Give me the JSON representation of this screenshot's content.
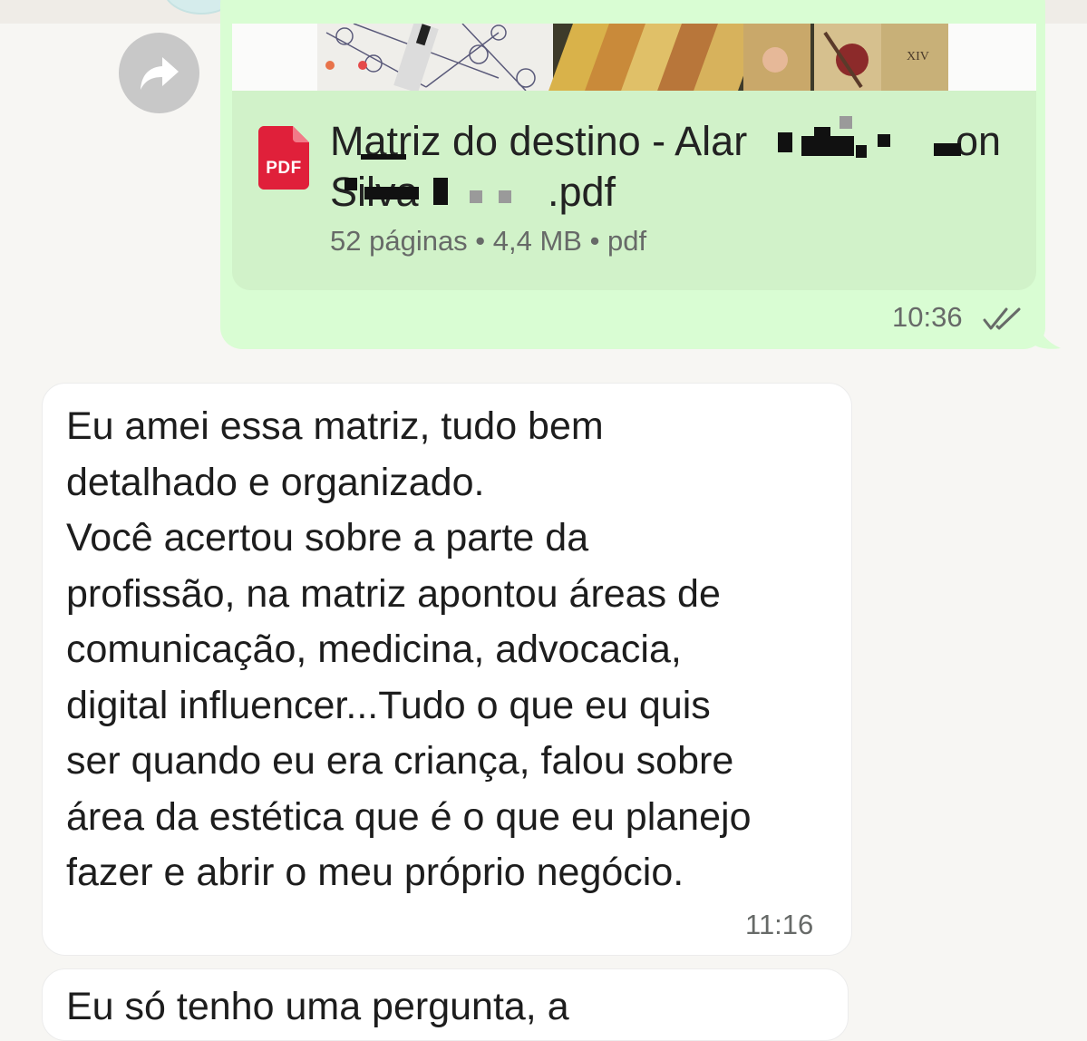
{
  "chat": {
    "forward_icon": "forward-arrow-icon",
    "outgoing": {
      "document": {
        "icon_label": "PDF",
        "name_line1": "Matriz do destino - Alar",
        "name_line1_end": "on",
        "name_line2_start": "Silva",
        "name_line2_end": ".pdf",
        "meta": "52 páginas • 4,4 MB • pdf"
      },
      "time": "10:36",
      "status_icon": "read-double-check-icon"
    },
    "incoming": {
      "lines": [
        "Eu amei essa matriz, tudo bem",
        "detalhado e organizado.",
        "Você acertou sobre a parte da",
        "profissão, na matriz apontou áreas de",
        "comunicação, medicina, advocacia,",
        "digital influencer...Tudo o que eu quis",
        "ser quando eu era criança, falou sobre",
        "área da estética que é o que eu planejo",
        "fazer e abrir o meu próprio negócio."
      ],
      "time": "11:16"
    },
    "incoming_next": {
      "partial_text": "Eu só tenho uma pergunta, a"
    },
    "colors": {
      "outgoing_bubble": "#d9fdd3",
      "document_card": "#d1f2c9",
      "pdf_red": "#e0203a",
      "incoming_bubble": "#ffffff",
      "background": "#f7f6f3"
    }
  }
}
